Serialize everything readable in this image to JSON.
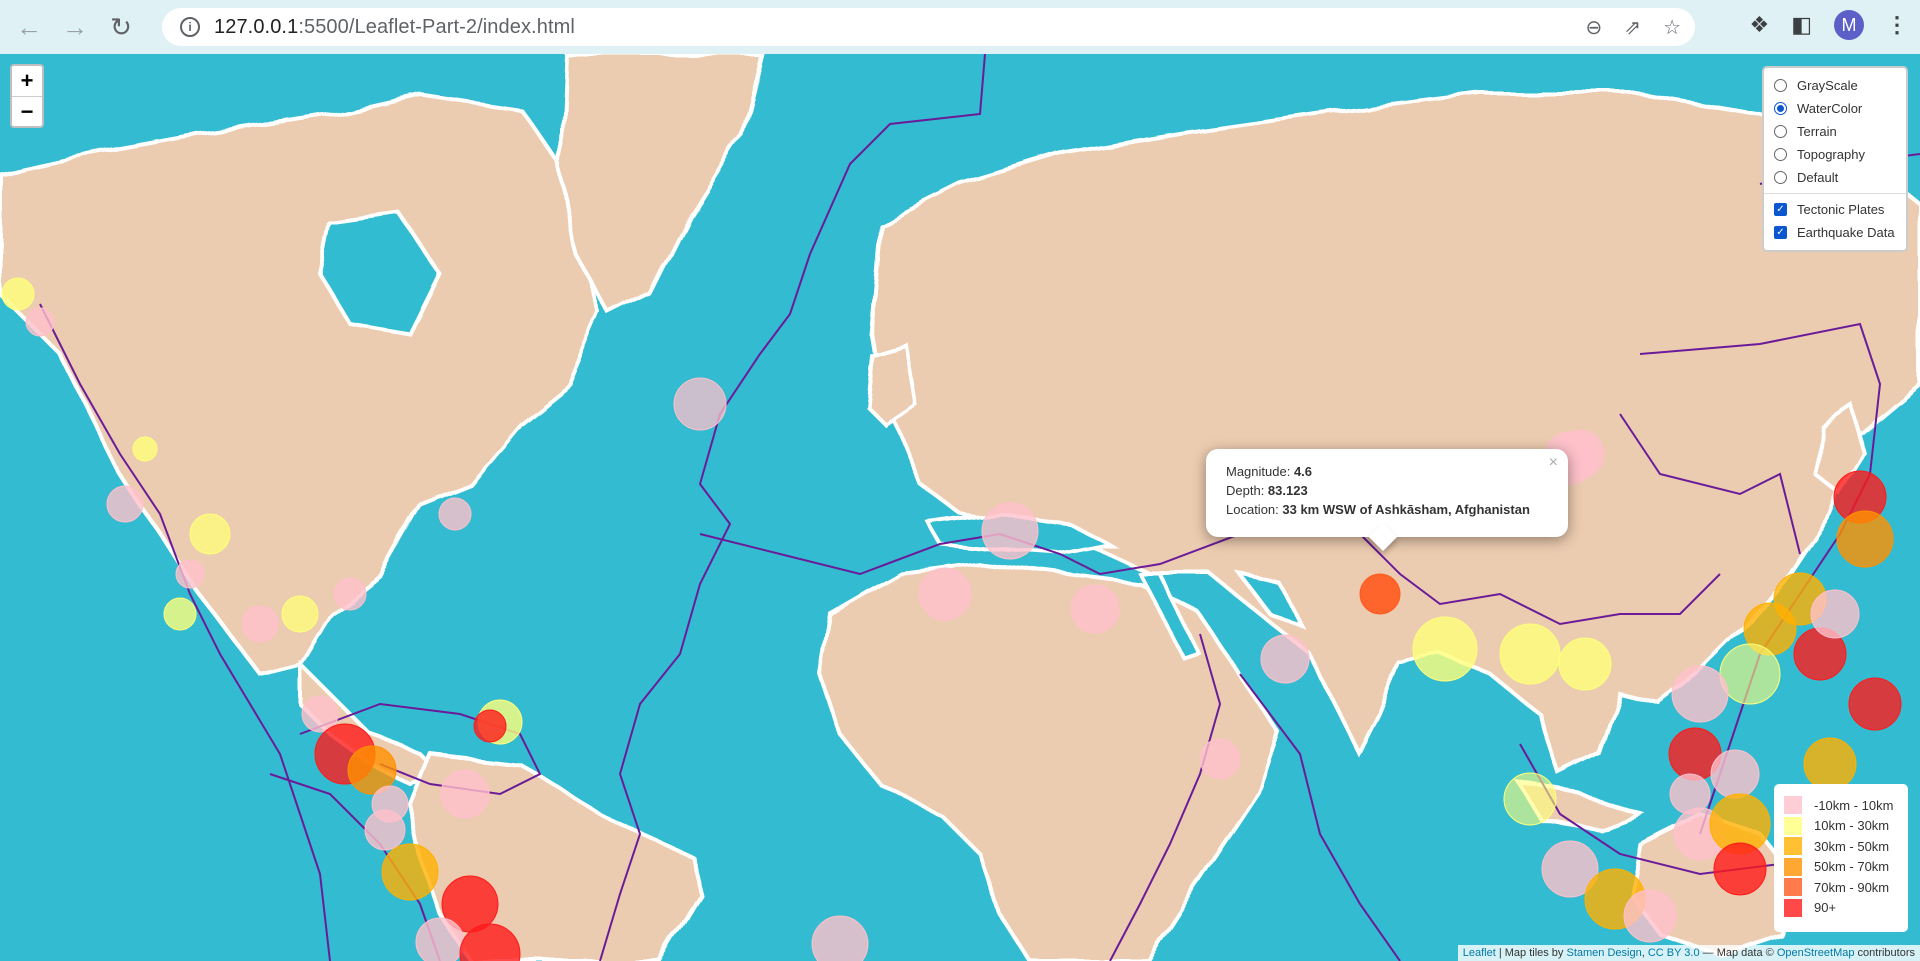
{
  "browser": {
    "url_host": "127.0.0.1",
    "url_path": ":5500/Leaflet-Part-2/index.html",
    "avatar_letter": "M"
  },
  "map": {
    "zoom_in": "+",
    "zoom_out": "−",
    "base_layers": [
      {
        "label": "GrayScale",
        "selected": false
      },
      {
        "label": "WaterColor",
        "selected": true
      },
      {
        "label": "Terrain",
        "selected": false
      },
      {
        "label": "Topography",
        "selected": false
      },
      {
        "label": "Default",
        "selected": false
      }
    ],
    "overlays": [
      {
        "label": "Tectonic Plates",
        "checked": true
      },
      {
        "label": "Earthquake Data",
        "checked": true
      }
    ],
    "popup": {
      "magnitude_label": "Magnitude: ",
      "magnitude": "4.6",
      "depth_label": "Depth: ",
      "depth": "83.123",
      "location_label": "Location: ",
      "location": "33 km WSW of Ashkāsham, Afghanistan",
      "close": "×"
    },
    "legend": [
      {
        "label": "-10km - 10km",
        "color": "#ffc0cb"
      },
      {
        "label": "10km - 30km",
        "color": "#ffff7a"
      },
      {
        "label": "30km - 50km",
        "color": "#ffb000"
      },
      {
        "label": "50km - 70km",
        "color": "#ff9100"
      },
      {
        "label": "70km - 90km",
        "color": "#ff5a1f"
      },
      {
        "label": "90+",
        "color": "#ff1a1a"
      }
    ],
    "attribution": {
      "leaflet": "Leaflet",
      "tiles_text": " | Map tiles by ",
      "stamen": "Stamen Design",
      "sep": ", ",
      "cc": "CC BY 3.0",
      "data_text": " — Map data © ",
      "osm": "OpenStreetMap",
      "contrib": " contributors"
    },
    "colors": {
      "ocean": "#2fb9cf",
      "land": "#edcfb6",
      "plate_line": "#6a1b9a"
    }
  }
}
